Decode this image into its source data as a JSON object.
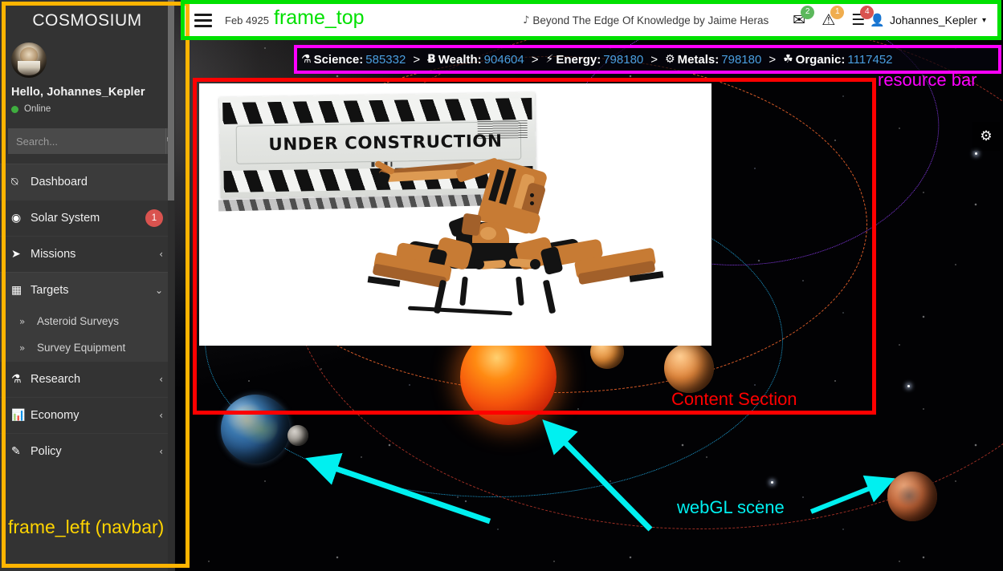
{
  "sidebar": {
    "brand": "COSMOSIUM",
    "avatar_name": "user-avatar",
    "greeting": "Hello, Johannes_Kepler",
    "status": "Online",
    "search": {
      "value": "",
      "placeholder": "Search...",
      "icon": "search-icon"
    },
    "items": [
      {
        "label": "Dashboard",
        "icon": "dashboard-icon",
        "badge": null,
        "chevron": null
      },
      {
        "label": "Solar System",
        "icon": "target-circle-icon",
        "badge": "1",
        "chevron": null
      },
      {
        "label": "Missions",
        "icon": "rocket-icon",
        "badge": null,
        "chevron": "‹"
      },
      {
        "label": "Targets",
        "icon": "grid-table-icon",
        "badge": null,
        "chevron": "⌄"
      },
      {
        "label": "Research",
        "icon": "flask-icon",
        "badge": null,
        "chevron": "‹"
      },
      {
        "label": "Economy",
        "icon": "bar-chart-icon",
        "badge": null,
        "chevron": "‹"
      },
      {
        "label": "Policy",
        "icon": "edit-square-icon",
        "badge": null,
        "chevron": "‹"
      }
    ],
    "sub_items": [
      {
        "label": "Asteroid Surveys",
        "icon": "double-chevron-icon"
      },
      {
        "label": "Survey Equipment",
        "icon": "double-chevron-icon"
      }
    ]
  },
  "topbar": {
    "menu_icon": "hamburger-icon",
    "date": "Feb 4925",
    "now_playing": "Beyond The Edge Of Knowledge by Jaime Heras",
    "music_icon": "music-note-icon",
    "icons": [
      {
        "name": "envelope-icon",
        "glyph": "✉",
        "badge": "2",
        "badge_color": "#5cb85c"
      },
      {
        "name": "warning-icon",
        "glyph": "⚠",
        "badge": "1",
        "badge_color": "#f0ad4e"
      },
      {
        "name": "tasks-icon",
        "glyph": "☰",
        "badge": "4",
        "badge_color": "#d9534f"
      }
    ],
    "user": {
      "icon": "user-icon",
      "name": "Johannes_Kepler",
      "caret": "▾"
    }
  },
  "resources": {
    "separator": ">",
    "value_color": "#4a9fe0",
    "items": [
      {
        "icon": "flask-icon",
        "glyph": "⚗",
        "name": "Science:",
        "value": "585332"
      },
      {
        "icon": "bitcoin-icon",
        "glyph": "Ƀ",
        "name": "Wealth:",
        "value": "904604"
      },
      {
        "icon": "bolt-icon",
        "glyph": "⚡",
        "name": "Energy:",
        "value": "798180"
      },
      {
        "icon": "gear-icon",
        "glyph": "⚙",
        "name": "Metals:",
        "value": "798180"
      },
      {
        "icon": "leaf-icon",
        "glyph": "☘",
        "name": "Organic:",
        "value": "1117452"
      }
    ]
  },
  "content": {
    "image_name": "under-construction-image",
    "sign_text": "UNDER CONSTRUCTION",
    "robot_name": "construction-robot-illustration"
  },
  "floating": {
    "gear_icon": "gear-icon",
    "gear_glyph": "⚙"
  },
  "annotations": {
    "frame_top": {
      "text": "frame_top",
      "color": "#00e000"
    },
    "resource_bar": {
      "text": "resource bar",
      "color": "#ff00ff"
    },
    "content": {
      "text": "Content Section",
      "color": "#ff0000"
    },
    "frame_left": {
      "text": "frame_left (navbar)",
      "color": "#ffd400"
    },
    "webgl": {
      "text": "webGL scene",
      "color": "#00f0f0"
    }
  },
  "scene": {
    "name": "solar-system-webgl-scene",
    "bodies": [
      "sun",
      "earth",
      "moon",
      "venus",
      "mercury",
      "mars"
    ],
    "orbit_colors": [
      "#8b3cf0",
      "#e8622a",
      "#1fa8e0",
      "#c0392b"
    ]
  }
}
